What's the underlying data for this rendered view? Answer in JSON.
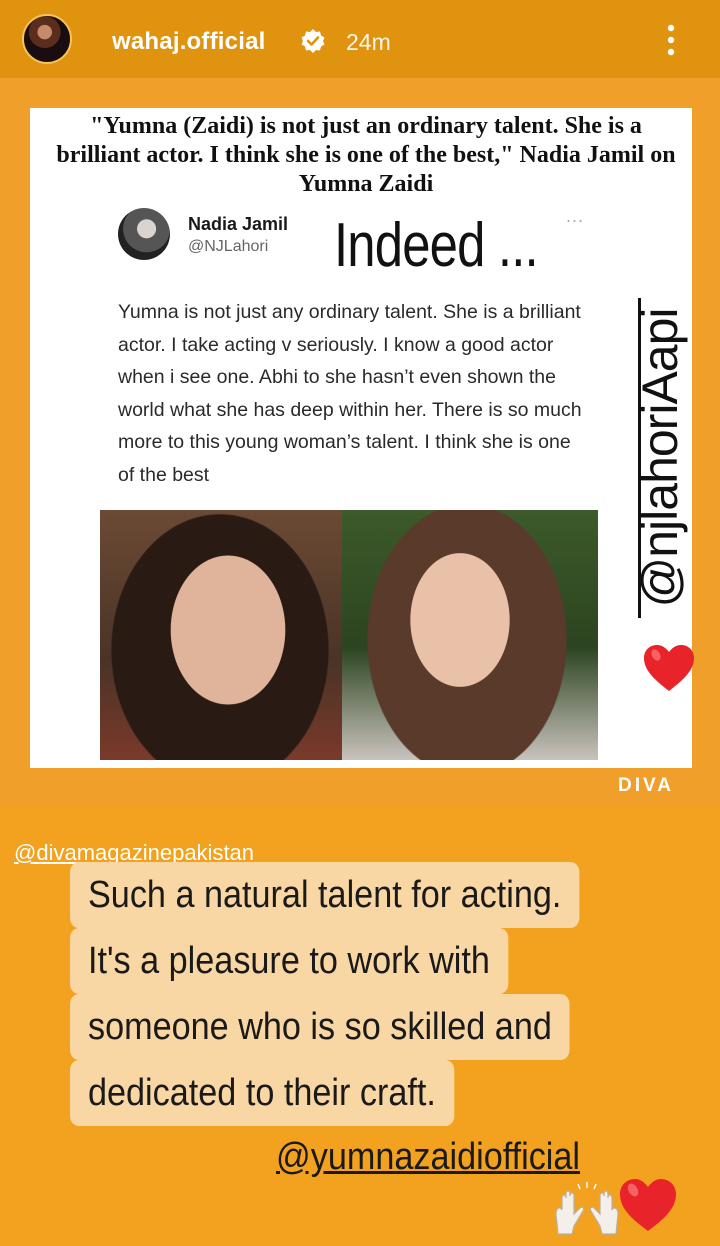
{
  "story": {
    "username": "wahaj.official",
    "time": "24m",
    "icons": [
      "avatar",
      "verified-badge-icon",
      "more-vertical-icon"
    ]
  },
  "post": {
    "headline": "\"Yumna (Zaidi) is not just an ordinary talent. She is a brilliant actor. I think she is one of the best,\" Nadia Jamil on Yumna Zaidi",
    "tweet_name": "Nadia Jamil",
    "tweet_handle": "@NJLahori",
    "tweet_more": "...",
    "tweet_text": "Yumna is not just any ordinary talent. She is a brilliant actor. I take acting v seriously. I know a good actor when i see one. Abhi to she hasn’t even shown the world what she has deep within her. There is so much more to this young woman’s talent. I think she is one of the best",
    "overlay_text": "Indeed ...",
    "vertical_mention": "@njlahoriAapi",
    "watermark": "DIVA"
  },
  "caption": {
    "source_mention": "@divamagazinepakistan",
    "lines": [
      "Such a natural talent for acting.",
      "It's a pleasure to work with",
      "someone who is so skilled and",
      "dedicated to their craft."
    ],
    "user_mention": "@yumnazaidiofficial"
  },
  "colors": {
    "background": "#f2a21f",
    "caption_bg": "#f9d7a4",
    "heart": "#e8232a"
  }
}
